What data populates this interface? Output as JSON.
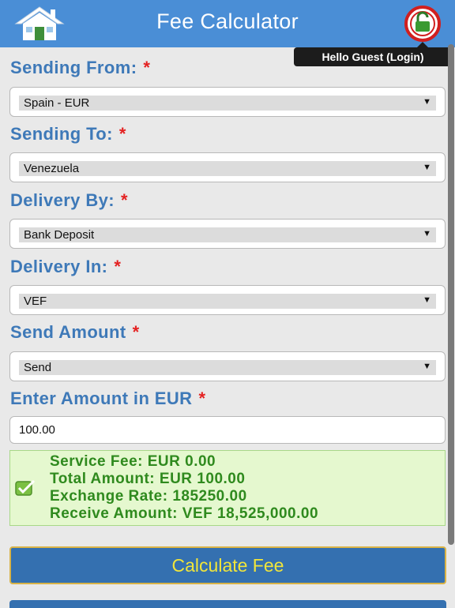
{
  "header": {
    "title": "Fee Calculator",
    "home_icon": "home-icon",
    "login_icon": "lock-icon",
    "tooltip": "Hello Guest (Login)",
    "color": "#4a8ed6"
  },
  "form": {
    "required_marker": "*",
    "sending_from": {
      "label": "Sending From:",
      "value": "Spain - EUR"
    },
    "sending_to": {
      "label": "Sending To:",
      "value": "Venezuela"
    },
    "delivery_by": {
      "label": "Delivery By:",
      "value": "Bank Deposit"
    },
    "delivery_in": {
      "label": "Delivery In:",
      "value": "VEF"
    },
    "send_amount": {
      "label": "Send Amount",
      "value": "Send"
    },
    "amount": {
      "label": "Enter Amount in EUR",
      "value": "100.00"
    },
    "dropdown_icon": "dropdown-arrow-icon"
  },
  "result": {
    "icon": "checkmark-icon",
    "service_fee": "Service Fee: EUR 0.00",
    "total_amount": "Total Amount: EUR 100.00",
    "exchange_rate": "Exchange Rate: 185250.00",
    "receive_amount": "Receive Amount: VEF 18,525,000.00"
  },
  "actions": {
    "calculate_label": "Calculate Fee"
  },
  "colors": {
    "label": "#3e79b8",
    "required": "#e42121",
    "result_text": "#2f8a1e",
    "result_bg": "#e5f8cf",
    "button_bg": "#3470b0",
    "button_text": "#f1e53a"
  }
}
